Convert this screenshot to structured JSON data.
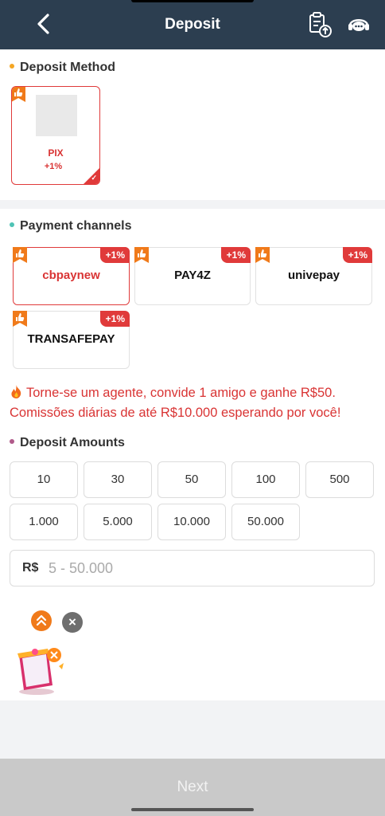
{
  "header": {
    "title": "Deposit",
    "bg_color": "#2c3e50",
    "icons": [
      "back-arrow-icon",
      "deposit-record-icon",
      "customer-service-icon"
    ]
  },
  "deposit_method": {
    "title": "Deposit Method",
    "dot_color": "#f5a623",
    "methods": [
      {
        "name": "PIX",
        "bonus": "+1%",
        "selected": true
      }
    ]
  },
  "payment_channels": {
    "title": "Payment channels",
    "dot_color": "#4fc3b5",
    "channels": [
      {
        "name": "cbpaynew",
        "tag": "+1%",
        "selected": true
      },
      {
        "name": "PAY4Z",
        "tag": "+1%",
        "selected": false
      },
      {
        "name": "univepay",
        "tag": "+1%",
        "selected": false
      },
      {
        "name": "TRANSAFEPAY",
        "tag": "+1%",
        "selected": false
      }
    ]
  },
  "promo": {
    "line1": "Torne-se um agente, convide 1 amigo e ganhe R$50.",
    "line2": "Comissões diárias de até R$10.000 esperando por você!",
    "color": "#d93434"
  },
  "deposit_amounts": {
    "title": "Deposit Amounts",
    "dot_color": "#b05a8a",
    "amounts": [
      "10",
      "30",
      "50",
      "100",
      "500",
      "1.000",
      "5.000",
      "10.000",
      "50.000"
    ],
    "currency": "R$",
    "placeholder": "5 - 50.000",
    "value": ""
  },
  "footer": {
    "next_label": "Next",
    "bg_color": "#c9c9c9"
  }
}
